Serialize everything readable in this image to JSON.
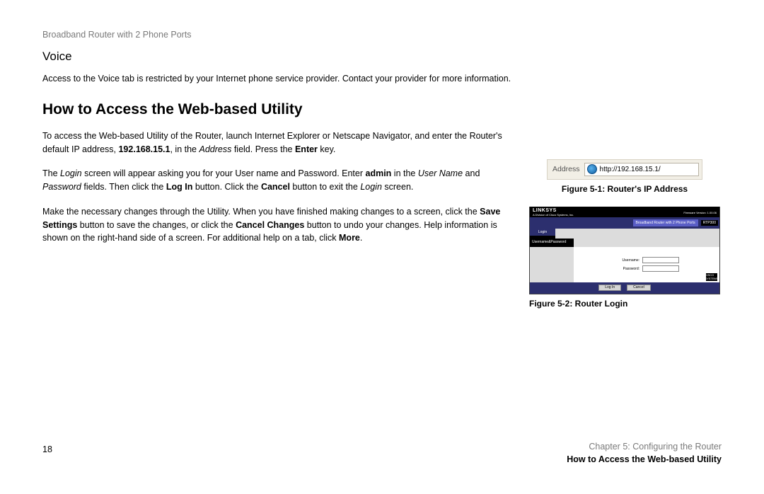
{
  "doc_title": "Broadband Router with 2 Phone Ports",
  "voice": {
    "heading": "Voice",
    "p1": "Access to the Voice tab is restricted by your Internet phone service provider. Contact your provider for more information."
  },
  "howto": {
    "heading": "How to Access the Web-based Utility",
    "p1_a": "To access the Web-based Utility of the Router, launch Internet Explorer or Netscape Navigator, and enter the Router's default IP address, ",
    "p1_ip": "192.168.15.1",
    "p1_b": ", in the ",
    "p1_addr": "Address",
    "p1_c": " field. Press the ",
    "p1_enter": "Enter",
    "p1_d": " key.",
    "p2_a": "The ",
    "p2_login": "Login",
    "p2_b": " screen will appear asking you for your User name and Password. Enter ",
    "p2_admin": "admin",
    "p2_c": " in the ",
    "p2_user": "User Name",
    "p2_d": " and ",
    "p2_pass": "Password",
    "p2_e": " fields. Then click the ",
    "p2_loginbtn": "Log In",
    "p2_f": " button. Click the ",
    "p2_cancel": "Cancel",
    "p2_g": " button to exit the ",
    "p2_loginscr": "Login",
    "p2_h": " screen.",
    "p3_a": "Make the necessary changes through the Utility. When you have finished making changes to a screen, click the ",
    "p3_save": "Save Settings",
    "p3_b": " button to save the changes, or click the ",
    "p3_cancel": "Cancel Changes",
    "p3_c": " button to undo your changes. Help information is shown on the right-hand side of a screen. For additional help on a tab, click ",
    "p3_more": "More",
    "p3_d": "."
  },
  "fig1": {
    "addr_label": "Address",
    "url": "http://192.168.15.1/",
    "caption": "Figure 5-1: Router's IP Address"
  },
  "fig2": {
    "brand": "LINKSYS",
    "brand_sub": "A Division of Cisco Systems, Inc.",
    "fw": "Firmware Version: 1.00.06",
    "product": "Broadband Router with 2 Phone Ports",
    "model": "RTP300",
    "tab": "Login",
    "section": "Username&Password",
    "user_label": "Username:",
    "pass_label": "Password:",
    "login_btn": "Log In",
    "cancel_btn": "Cancel",
    "cisco": "CISCO SYSTEMS",
    "caption": "Figure 5-2: Router Login"
  },
  "footer": {
    "page": "18",
    "chapter": "Chapter 5: Configuring the Router",
    "section": "How to Access the Web-based Utility"
  }
}
